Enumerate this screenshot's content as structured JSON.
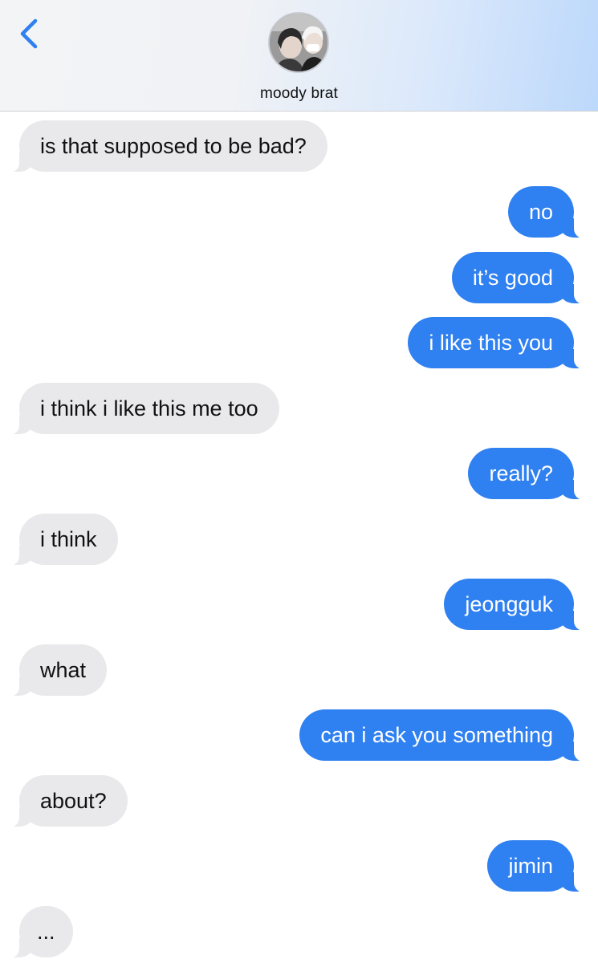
{
  "header": {
    "contact_name": "moody brat",
    "back_icon": "chevron-left-icon",
    "accent_color": "#2f80f0"
  },
  "messages": [
    {
      "from": "them",
      "text": "is that supposed to be bad?"
    },
    {
      "from": "me",
      "text": "no"
    },
    {
      "from": "me",
      "text": "it’s good"
    },
    {
      "from": "me",
      "text": "i like this you"
    },
    {
      "from": "them",
      "text": "i think i like this me too"
    },
    {
      "from": "me",
      "text": "really?"
    },
    {
      "from": "them",
      "text": "i think"
    },
    {
      "from": "me",
      "text": "jeongguk"
    },
    {
      "from": "them",
      "text": "what"
    },
    {
      "from": "me",
      "text": "can i ask you something"
    },
    {
      "from": "them",
      "text": "about?"
    },
    {
      "from": "me",
      "text": "jimin"
    },
    {
      "from": "them",
      "text": "..."
    }
  ]
}
